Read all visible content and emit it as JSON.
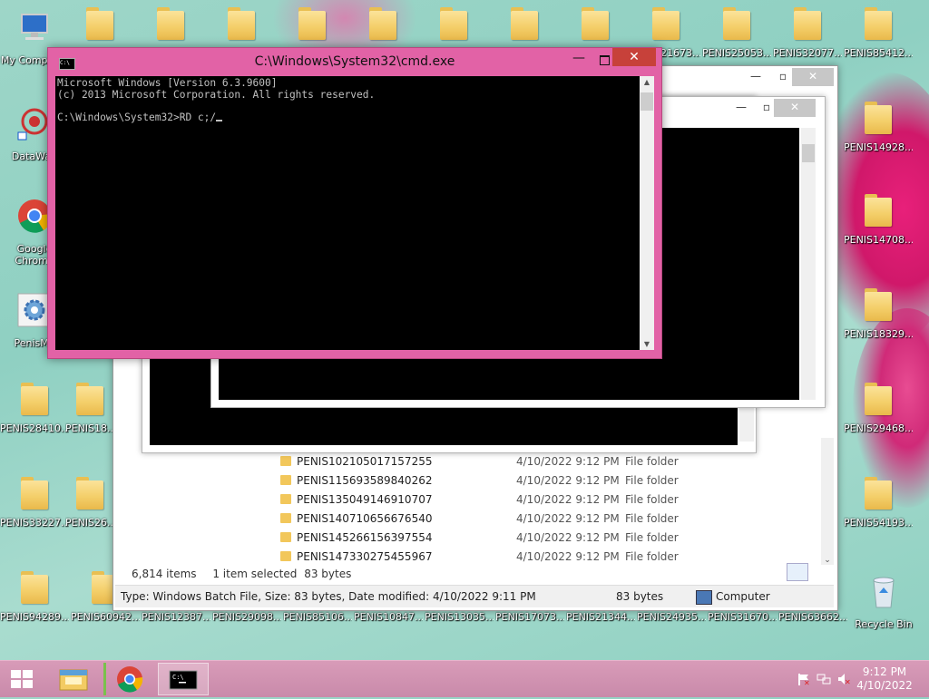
{
  "desktop": {
    "left_icons": [
      {
        "label": "My Computer",
        "icon": "computer-icon"
      },
      {
        "label": "DataWag",
        "icon": "app-icon"
      },
      {
        "label": "Google Chrome",
        "icon": "chrome-icon"
      },
      {
        "label": "PenisMo",
        "icon": "settings-icon"
      },
      {
        "label": "PENIS28410...",
        "icon": "folder-icon"
      },
      {
        "label": "PENIS18...",
        "icon": "folder-icon"
      },
      {
        "label": "PENIS33227...",
        "icon": "folder-icon"
      },
      {
        "label": "PENIS26...",
        "icon": "folder-icon"
      }
    ],
    "top_icons": [
      "",
      "",
      "",
      "",
      "",
      "",
      "",
      "",
      "PENIS21673...",
      "PENIS25053...",
      "PENIS32077...",
      "PENIS85412..."
    ],
    "right_icons": [
      "PENIS14928...",
      "PENIS14708...",
      "PENIS18329...",
      "PENIS29468...",
      "PENIS54193..."
    ],
    "bottom_icons": [
      "PENIS94289...",
      "PENIS60942...",
      "PENIS12387...",
      "PENIS29098...",
      "PENIS85106...",
      "PENIS10847...",
      "PENIS13035...",
      "PENIS17073...",
      "PENIS21344...",
      "PENIS24935...",
      "PENIS31670...",
      "PENIS63662..."
    ],
    "recycle_bin_label": "Recycle Bin"
  },
  "cmd": {
    "title": "C:\\Windows\\System32\\cmd.exe",
    "icon_text": "C:\\",
    "lines": [
      "Microsoft Windows [Version 6.3.9600]",
      "(c) 2013 Microsoft Corporation. All rights reserved.",
      "",
      "C:\\Windows\\System32>RD c;/"
    ],
    "minimize": "—",
    "close": "✕"
  },
  "explorer": {
    "rows": [
      {
        "name": "PENIS102105017157255",
        "date": "4/10/2022 9:12 PM",
        "type": "File folder"
      },
      {
        "name": "PENIS115693589840262",
        "date": "4/10/2022 9:12 PM",
        "type": "File folder"
      },
      {
        "name": "PENIS135049146910707",
        "date": "4/10/2022 9:12 PM",
        "type": "File folder"
      },
      {
        "name": "PENIS140710656676540",
        "date": "4/10/2022 9:12 PM",
        "type": "File folder"
      },
      {
        "name": "PENIS145266156397554",
        "date": "4/10/2022 9:12 PM",
        "type": "File folder"
      },
      {
        "name": "PENIS147330275455967",
        "date": "4/10/2022 9:12 PM",
        "type": "File folder"
      }
    ],
    "items_count": "6,814 items",
    "selected": "1 item selected",
    "selected_size": "83 bytes",
    "details": "Type: Windows Batch File, Size: 83 bytes, Date modified: 4/10/2022 9:11 PM",
    "details_size": "83 bytes",
    "location": "Computer"
  },
  "taskbar": {
    "time": "9:12 PM",
    "date": "4/10/2022"
  }
}
